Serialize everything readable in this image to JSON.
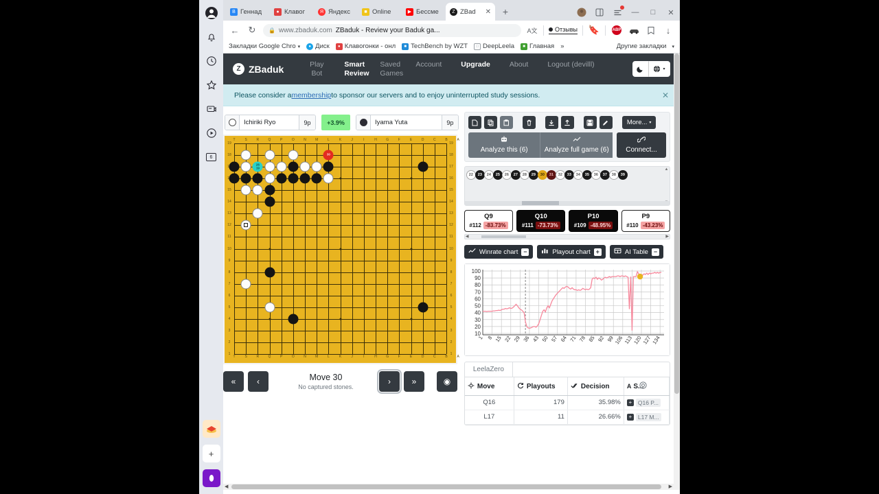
{
  "browser": {
    "tabs": [
      {
        "label": "Геннад",
        "fav": "vk",
        "color": "#2787f5",
        "glyph": "B"
      },
      {
        "label": "Клавог",
        "fav": "car",
        "color": "#e04141",
        "glyph": "●"
      },
      {
        "label": "Яндекс",
        "fav": "ya",
        "color": "#ff3333",
        "glyph": "Я"
      },
      {
        "label": "Online ",
        "fav": "puzzle",
        "color": "#f0c419",
        "glyph": "░"
      },
      {
        "label": "Бессме",
        "fav": "yt",
        "color": "#ff0000",
        "glyph": "▶"
      },
      {
        "label": "ZBad",
        "fav": "zb",
        "color": "#1a1a1a",
        "glyph": "Z"
      }
    ],
    "active_tab_index": 5,
    "newtab_label": "+",
    "window_controls": {
      "minimize": "—",
      "maximize": "□",
      "close": "✕"
    },
    "nav": {
      "back": "←",
      "reload": "↻"
    },
    "omnibox": {
      "lock": "ὑ2",
      "url": "www.zbaduk.com",
      "title": "ZBaduk - Review your Baduk ga...",
      "translate_icon": "A文"
    },
    "feedback_label": "Отзывы",
    "toolbar_icons": [
      "bookmark-icon",
      "adblock-icon",
      "extension-car-icon",
      "split-icon",
      "download-icon"
    ],
    "adblock_label": "ABP",
    "bookmarks": [
      {
        "label": "Закладки Google Chro",
        "caret": "▾",
        "fav": "folder",
        "color": "transparent"
      },
      {
        "label": "Диск",
        "fav": "drive",
        "color": "#1aa3e8"
      },
      {
        "label": "Клавогонки - онл",
        "fav": "car",
        "color": "#e04141"
      },
      {
        "label": "TechBench by WZT",
        "fav": "win",
        "color": "#1f8bd8"
      },
      {
        "label": "DeepLeela",
        "fav": "doc",
        "color": "#ffffff"
      },
      {
        "label": "Главная",
        "fav": "bottle",
        "color": "#3f9f2f"
      }
    ],
    "bookmarks_overflow": "»",
    "other_bookmarks": "Другие закладки",
    "other_bookmarks_caret": "▾"
  },
  "rail": {
    "items": [
      "account-icon",
      "bell-icon",
      "clock-icon",
      "star-icon",
      "chat-icon",
      "play-icon",
      "pages-icon"
    ],
    "pages_badge": "6",
    "bottom": [
      "stack-icon",
      "add-icon",
      "opera-icon"
    ]
  },
  "navbar": {
    "brand": "ZBaduk",
    "brand_glyph": "Z",
    "links": [
      {
        "label": "Play Bot",
        "active": false
      },
      {
        "label": "Smart Review",
        "active": true
      },
      {
        "label": "Saved Games",
        "active": false
      },
      {
        "label": "Account",
        "active": false
      },
      {
        "label": "Upgrade",
        "active": true
      },
      {
        "label": "About",
        "active": false
      },
      {
        "label": "Logout",
        "active": false,
        "sub": "(devilll)"
      }
    ],
    "dark_mode_icon": "☾",
    "lang_icon": "⊕",
    "lang_caret": "▾"
  },
  "alert": {
    "pre": "Please consider a ",
    "link": "membership",
    "post": " to sponsor our servers and to enjoy uninterrupted study sessions.",
    "close": "✕"
  },
  "players": {
    "white": {
      "name": "Ichiriki Ryo",
      "rank": "9p",
      "stone": "white"
    },
    "winrate_badge": "+3.9%",
    "black": {
      "name": "Iyama Yuta",
      "rank": "9p",
      "stone": "black"
    }
  },
  "board": {
    "size": 19,
    "col_labels": [
      "T",
      "S",
      "R",
      "Q",
      "P",
      "O",
      "N",
      "M",
      "L",
      "K",
      "J",
      "I",
      "H",
      "G",
      "F",
      "E",
      "D",
      "C",
      "B",
      "A"
    ],
    "row_labels": [
      "19",
      "18",
      "17",
      "16",
      "15",
      "14",
      "13",
      "12",
      "11",
      "10",
      "9",
      "8",
      "7",
      "6",
      "5",
      "4",
      "3",
      "2",
      "1"
    ],
    "stones": [
      {
        "c": 1,
        "r": 17,
        "color": "w"
      },
      {
        "c": 3,
        "r": 17,
        "color": "w"
      },
      {
        "c": 5,
        "r": 17,
        "color": "w"
      },
      {
        "c": 8,
        "r": 17,
        "color": "b",
        "last": true,
        "label": "30"
      },
      {
        "c": 0,
        "r": 16,
        "color": "b"
      },
      {
        "c": 1,
        "r": 16,
        "color": "w"
      },
      {
        "c": 2,
        "r": 16,
        "color": "b",
        "marked": true,
        "label_top": "26",
        "label_bot": "19"
      },
      {
        "c": 3,
        "r": 16,
        "color": "w"
      },
      {
        "c": 4,
        "r": 16,
        "color": "w"
      },
      {
        "c": 5,
        "r": 16,
        "color": "b"
      },
      {
        "c": 6,
        "r": 16,
        "color": "w"
      },
      {
        "c": 7,
        "r": 16,
        "color": "w"
      },
      {
        "c": 8,
        "r": 16,
        "color": "b"
      },
      {
        "c": 16,
        "r": 16,
        "color": "b"
      },
      {
        "c": 0,
        "r": 15,
        "color": "b"
      },
      {
        "c": 1,
        "r": 15,
        "color": "b"
      },
      {
        "c": 2,
        "r": 15,
        "color": "b"
      },
      {
        "c": 3,
        "r": 15,
        "color": "w"
      },
      {
        "c": 4,
        "r": 15,
        "color": "b"
      },
      {
        "c": 5,
        "r": 15,
        "color": "b"
      },
      {
        "c": 6,
        "r": 15,
        "color": "b"
      },
      {
        "c": 7,
        "r": 15,
        "color": "b"
      },
      {
        "c": 8,
        "r": 15,
        "color": "w"
      },
      {
        "c": 1,
        "r": 14,
        "color": "w"
      },
      {
        "c": 2,
        "r": 14,
        "color": "w"
      },
      {
        "c": 3,
        "r": 14,
        "color": "b"
      },
      {
        "c": 3,
        "r": 13,
        "color": "b"
      },
      {
        "c": 2,
        "r": 12,
        "color": "w"
      },
      {
        "c": 1,
        "r": 11,
        "color": "w",
        "square": true
      },
      {
        "c": 3,
        "r": 7,
        "color": "b"
      },
      {
        "c": 1,
        "r": 6,
        "color": "w"
      },
      {
        "c": 3,
        "r": 4,
        "color": "w"
      },
      {
        "c": 16,
        "r": 4,
        "color": "b"
      },
      {
        "c": 5,
        "r": 3,
        "color": "b"
      }
    ]
  },
  "move_controls": {
    "first": "«",
    "prev": "‹",
    "next": "›",
    "last": "»",
    "eye": "◉",
    "move_label": "Move 30",
    "captures_label": "No captured stones."
  },
  "tools": {
    "icon_buttons": [
      "new-file-icon",
      "copy-icon",
      "paste-icon",
      "trash-icon",
      "download-icon",
      "upload-icon",
      "save-icon",
      "edit-icon"
    ],
    "more_label": "More...",
    "more_caret": "▾",
    "analyze_this": "Analyze this (6)",
    "analyze_full": "Analyze full game (6)",
    "connect": "Connect...",
    "analyze_this_icon": "robot-icon",
    "analyze_full_icon": "chart-icon",
    "connect_icon": "link-icon"
  },
  "move_strip": {
    "moves": [
      {
        "n": "22",
        "color": "w"
      },
      {
        "n": "23",
        "color": "b"
      },
      {
        "n": "24",
        "color": "w"
      },
      {
        "n": "25",
        "color": "b"
      },
      {
        "n": "26",
        "color": "w"
      },
      {
        "n": "27",
        "color": "b"
      },
      {
        "n": "28",
        "color": "w"
      },
      {
        "n": "29",
        "color": "b"
      },
      {
        "n": "30",
        "color": "gold"
      },
      {
        "n": "31",
        "color": "dark-red"
      },
      {
        "n": "32",
        "color": "w"
      },
      {
        "n": "33",
        "color": "b"
      },
      {
        "n": "34",
        "color": "w"
      },
      {
        "n": "35",
        "color": "b"
      },
      {
        "n": "36",
        "color": "w"
      },
      {
        "n": "37",
        "color": "b"
      },
      {
        "n": "38",
        "color": "w"
      },
      {
        "n": "39",
        "color": "b"
      }
    ]
  },
  "move_cards": [
    {
      "move": "Q9",
      "num": "#112",
      "pct": "-83.73%",
      "theme": "wht"
    },
    {
      "move": "Q10",
      "num": "#111",
      "pct": "-73.73%",
      "theme": "blk"
    },
    {
      "move": "P10",
      "num": "#109",
      "pct": "-48.95%",
      "theme": "blk"
    },
    {
      "move": "P9",
      "num": "#110",
      "pct": "-43.23%",
      "theme": "wht"
    }
  ],
  "chips": [
    {
      "label": "Winrate chart",
      "state": "−",
      "icon": "line-chart-icon"
    },
    {
      "label": "Playout chart",
      "state": "+",
      "icon": "bar-chart-icon"
    },
    {
      "label": "AI Table",
      "state": "−",
      "icon": "table-icon"
    }
  ],
  "ai_table": {
    "engine_tab": "LeelaZero",
    "headers": [
      {
        "label": "Move",
        "icon": "target-icon"
      },
      {
        "label": "Playouts",
        "icon": "refresh-icon"
      },
      {
        "label": "Decision",
        "icon": "check-icon"
      },
      {
        "label": "S...",
        "icon": "gear-icon",
        "prefix_icon": "font-icon",
        "prefix": "A"
      }
    ],
    "rows": [
      {
        "move": "Q16",
        "playouts": "179",
        "decision": "35.98%",
        "seq": "Q16 P..."
      },
      {
        "move": "L17",
        "playouts": "11",
        "decision": "26.66%",
        "seq": "L17 M..."
      }
    ]
  },
  "chart_data": {
    "type": "line",
    "title": "Winrate chart",
    "xlabel": "",
    "ylabel": "",
    "x_ticks": [
      "1",
      "8",
      "15",
      "22",
      "29",
      "36",
      "43",
      "50",
      "57",
      "64",
      "71",
      "78",
      "85",
      "92",
      "99",
      "106",
      "113",
      "120",
      "127",
      "134"
    ],
    "y_ticks": [
      10,
      20,
      30,
      40,
      50,
      60,
      70,
      80,
      90,
      100
    ],
    "ylim": [
      8,
      102
    ],
    "xlim": [
      1,
      137
    ],
    "grid": true,
    "legend": "none",
    "line_color": "#f7889c",
    "marker": {
      "x": 119,
      "y": 92,
      "color": "#e8b420",
      "label": "current-move-marker"
    },
    "cursor_line_x": 33,
    "series": [
      {
        "name": "Winrate",
        "values": [
          42,
          42,
          42,
          41.5,
          42,
          42,
          42,
          42,
          42.5,
          42.5,
          43,
          43,
          43.5,
          43,
          44,
          45,
          45,
          46,
          45.5,
          46,
          47,
          46,
          46.5,
          48,
          50,
          52,
          50,
          47,
          45,
          44,
          42,
          40,
          27,
          20,
          18,
          17.5,
          18,
          19,
          20,
          20,
          19,
          21,
          24,
          30,
          36,
          42,
          44,
          41,
          47,
          50,
          47,
          52,
          57,
          60,
          63,
          66,
          68,
          70,
          72,
          74,
          76,
          75,
          77,
          78,
          77,
          75,
          74,
          76,
          74,
          73,
          73,
          72,
          73,
          72,
          73,
          75,
          74,
          73,
          74,
          73,
          74,
          76,
          88,
          90,
          89,
          91,
          88,
          90,
          89,
          87,
          88,
          90,
          91,
          90,
          91,
          92,
          91,
          92,
          92,
          92,
          92,
          93,
          93,
          92,
          93,
          93,
          92,
          93,
          92,
          91,
          45,
          92,
          14,
          92,
          92,
          92,
          99,
          96,
          92,
          95,
          94,
          96,
          95,
          97,
          95,
          97,
          96,
          97,
          97,
          98,
          97,
          98,
          97,
          98,
          98
        ]
      }
    ]
  }
}
